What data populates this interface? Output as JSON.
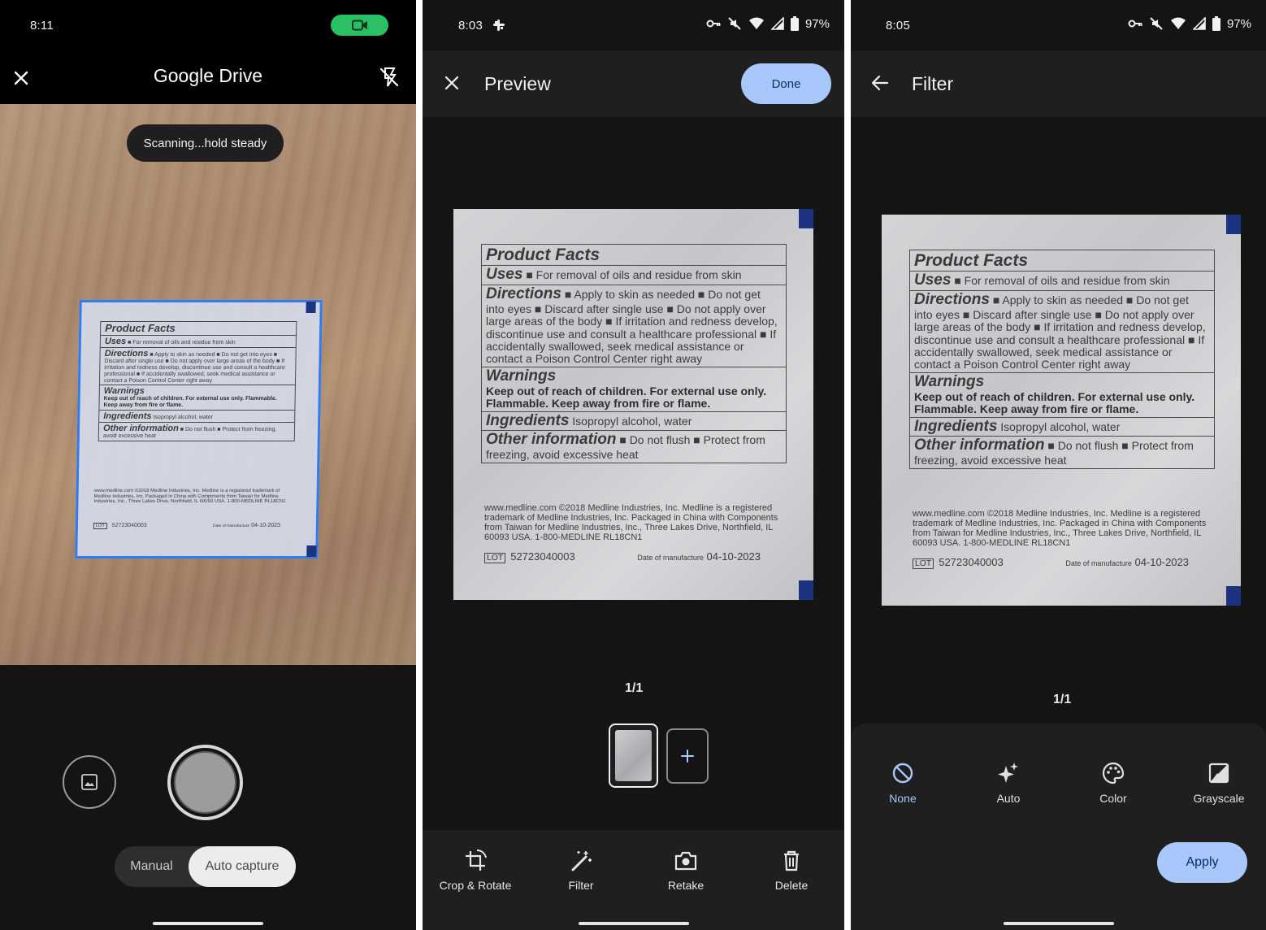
{
  "screen1": {
    "status_time": "8:11",
    "title": "Google Drive",
    "toast": "Scanning...hold steady",
    "modes": {
      "manual": "Manual",
      "auto": "Auto capture"
    }
  },
  "screen2": {
    "status_time": "8:03",
    "battery": "97%",
    "title": "Preview",
    "done": "Done",
    "page_count": "1/1",
    "tools": {
      "crop": "Crop & Rotate",
      "filter": "Filter",
      "retake": "Retake",
      "delete": "Delete"
    }
  },
  "screen3": {
    "status_time": "8:05",
    "battery": "97%",
    "title": "Filter",
    "page_count": "1/1",
    "filters": {
      "none": "None",
      "auto": "Auto",
      "color": "Color",
      "grayscale": "Grayscale"
    },
    "apply": "Apply"
  },
  "label": {
    "facts_title": "Product Facts",
    "uses_hd": "Uses",
    "uses_bd": "■ For removal of oils and residue from skin",
    "directions_hd": "Directions",
    "directions_bd": "■ Apply to skin as needed ■ Do not get into eyes ■ Discard after single use ■ Do not apply over large areas of the body ■ If irritation and redness develop, discontinue use and consult a healthcare professional ■ If accidentally swallowed, seek medical assistance or contact a Poison Control Center right away",
    "warnings_hd": "Warnings",
    "warnings_bd": "Keep out of reach of children. For external use only. Flammable. Keep away from fire or flame.",
    "ingredients_hd": "Ingredients",
    "ingredients_bd": "Isopropyl alcohol, water",
    "other_hd": "Other information",
    "other_bd": "■ Do not flush ■ Protect from freezing, avoid excessive heat",
    "fine_print": "www.medline.com ©2018 Medline Industries, Inc. Medline is a registered trademark of Medline Industries, Inc. Packaged in China with Components from Taiwan for Medline Industries, Inc., Three Lakes Drive, Northfield, IL 60093 USA. 1-800-MEDLINE RL18CN1",
    "lot_tag": "LOT",
    "lot": "52723040003",
    "date_label": "Date of manufacture",
    "date": "04-10-2023"
  }
}
